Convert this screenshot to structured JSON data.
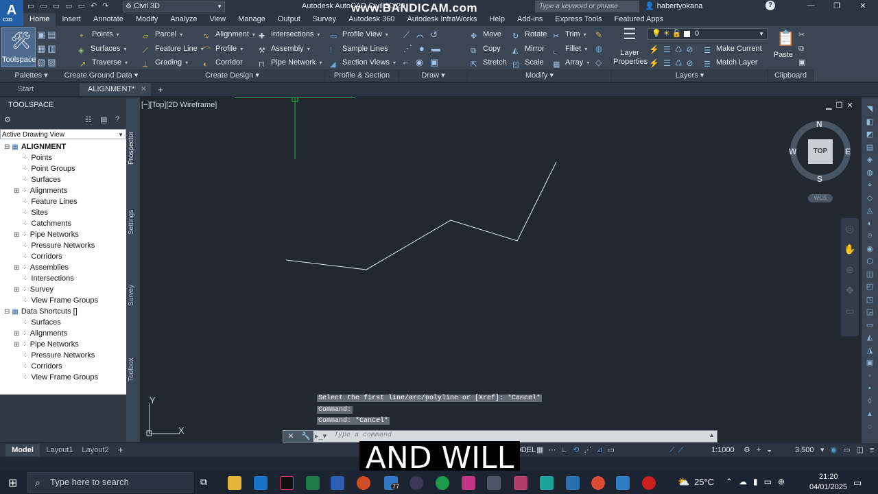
{
  "titlebar": {
    "workspace": "Civil 3D",
    "app_title": "Autodesk AutoCAD Civil 3D 2018",
    "watermark": "www.BANDICAM.com",
    "search_placeholder": "Type a keyword or phrase",
    "user": "habertyokana"
  },
  "ribbon_tabs": [
    "Home",
    "Insert",
    "Annotate",
    "Modify",
    "Analyze",
    "View",
    "Manage",
    "Output",
    "Survey",
    "Autodesk 360",
    "Autodesk InfraWorks",
    "Help",
    "Add-ins",
    "Express Tools",
    "Featured Apps"
  ],
  "ribbon": {
    "toolspace": "Toolspace",
    "ground": {
      "points": "Points",
      "surfaces": "Surfaces",
      "traverse": "Traverse"
    },
    "design": {
      "parcel": "Parcel",
      "feature_line": "Feature Line",
      "grading": "Grading",
      "alignment": "Alignment",
      "profile": "Profile",
      "corridor": "Corridor",
      "intersections": "Intersections",
      "assembly": "Assembly",
      "pipe_network": "Pipe Network"
    },
    "views": {
      "profile_view": "Profile View",
      "sample_lines": "Sample Lines",
      "section_views": "Section Views"
    },
    "modify": {
      "move": "Move",
      "rotate": "Rotate",
      "trim": "Trim",
      "copy": "Copy",
      "mirror": "Mirror",
      "fillet": "Fillet",
      "stretch": "Stretch",
      "scale": "Scale",
      "array": "Array"
    },
    "layers": {
      "current_layer": "0",
      "layer_properties": "Layer Properties",
      "make_current": "Make Current",
      "match_layer": "Match Layer"
    },
    "clipboard": {
      "paste": "Paste"
    },
    "panels": {
      "palettes": "Palettes",
      "create_ground_data": "Create Ground Data",
      "create_design": "Create Design",
      "profile_section_views": "Profile & Section Views",
      "draw": "Draw",
      "modify": "Modify",
      "layers": "Layers",
      "clipboard": "Clipboard"
    }
  },
  "doc_tabs": {
    "start": "Start",
    "active": "ALIGNMENT*"
  },
  "toolspace": {
    "title": "TOOLSPACE",
    "view_select": "Active Drawing View",
    "tree": [
      {
        "label": "ALIGNMENT",
        "level": 0,
        "bold": true
      },
      {
        "label": "Points",
        "level": 1
      },
      {
        "label": "Point Groups",
        "level": 1
      },
      {
        "label": "Surfaces",
        "level": 1
      },
      {
        "label": "Alignments",
        "level": 1
      },
      {
        "label": "Feature Lines",
        "level": 1
      },
      {
        "label": "Sites",
        "level": 1
      },
      {
        "label": "Catchments",
        "level": 1
      },
      {
        "label": "Pipe Networks",
        "level": 1
      },
      {
        "label": "Pressure Networks",
        "level": 1
      },
      {
        "label": "Corridors",
        "level": 1
      },
      {
        "label": "Assemblies",
        "level": 1
      },
      {
        "label": "Intersections",
        "level": 1
      },
      {
        "label": "Survey",
        "level": 1
      },
      {
        "label": "View Frame Groups",
        "level": 1
      },
      {
        "label": "Data Shortcuts []",
        "level": 0
      },
      {
        "label": "Surfaces",
        "level": 1
      },
      {
        "label": "Alignments",
        "level": 1
      },
      {
        "label": "Pipe Networks",
        "level": 1
      },
      {
        "label": "Pressure Networks",
        "level": 1
      },
      {
        "label": "Corridors",
        "level": 1
      },
      {
        "label": "View Frame Groups",
        "level": 1
      }
    ],
    "side_tabs": [
      "Prospector",
      "Settings",
      "Survey",
      "Toolbox"
    ]
  },
  "viewport": {
    "label": "[−][Top][2D Wireframe]",
    "viewcube": {
      "n": "N",
      "s": "S",
      "e": "E",
      "w": "W",
      "top": "TOP",
      "wcs": "WCS"
    },
    "ucs": {
      "x": "X",
      "y": "Y"
    }
  },
  "command": {
    "history": [
      "Select the first line/arc/polyline or [Xref]: *Cancel*",
      "Command:",
      "Command: *Cancel*"
    ],
    "placeholder": "Type a command"
  },
  "layout_tabs": [
    "Model",
    "Layout1",
    "Layout2"
  ],
  "status": {
    "model": "MODEL",
    "scale": "1:1000",
    "value": "3.500"
  },
  "caption": "AND WILL",
  "taskbar": {
    "search_placeholder": "Type here to search",
    "temperature": "25°C",
    "time": "21:20",
    "date": "04/01/2025",
    "badge": "77"
  }
}
